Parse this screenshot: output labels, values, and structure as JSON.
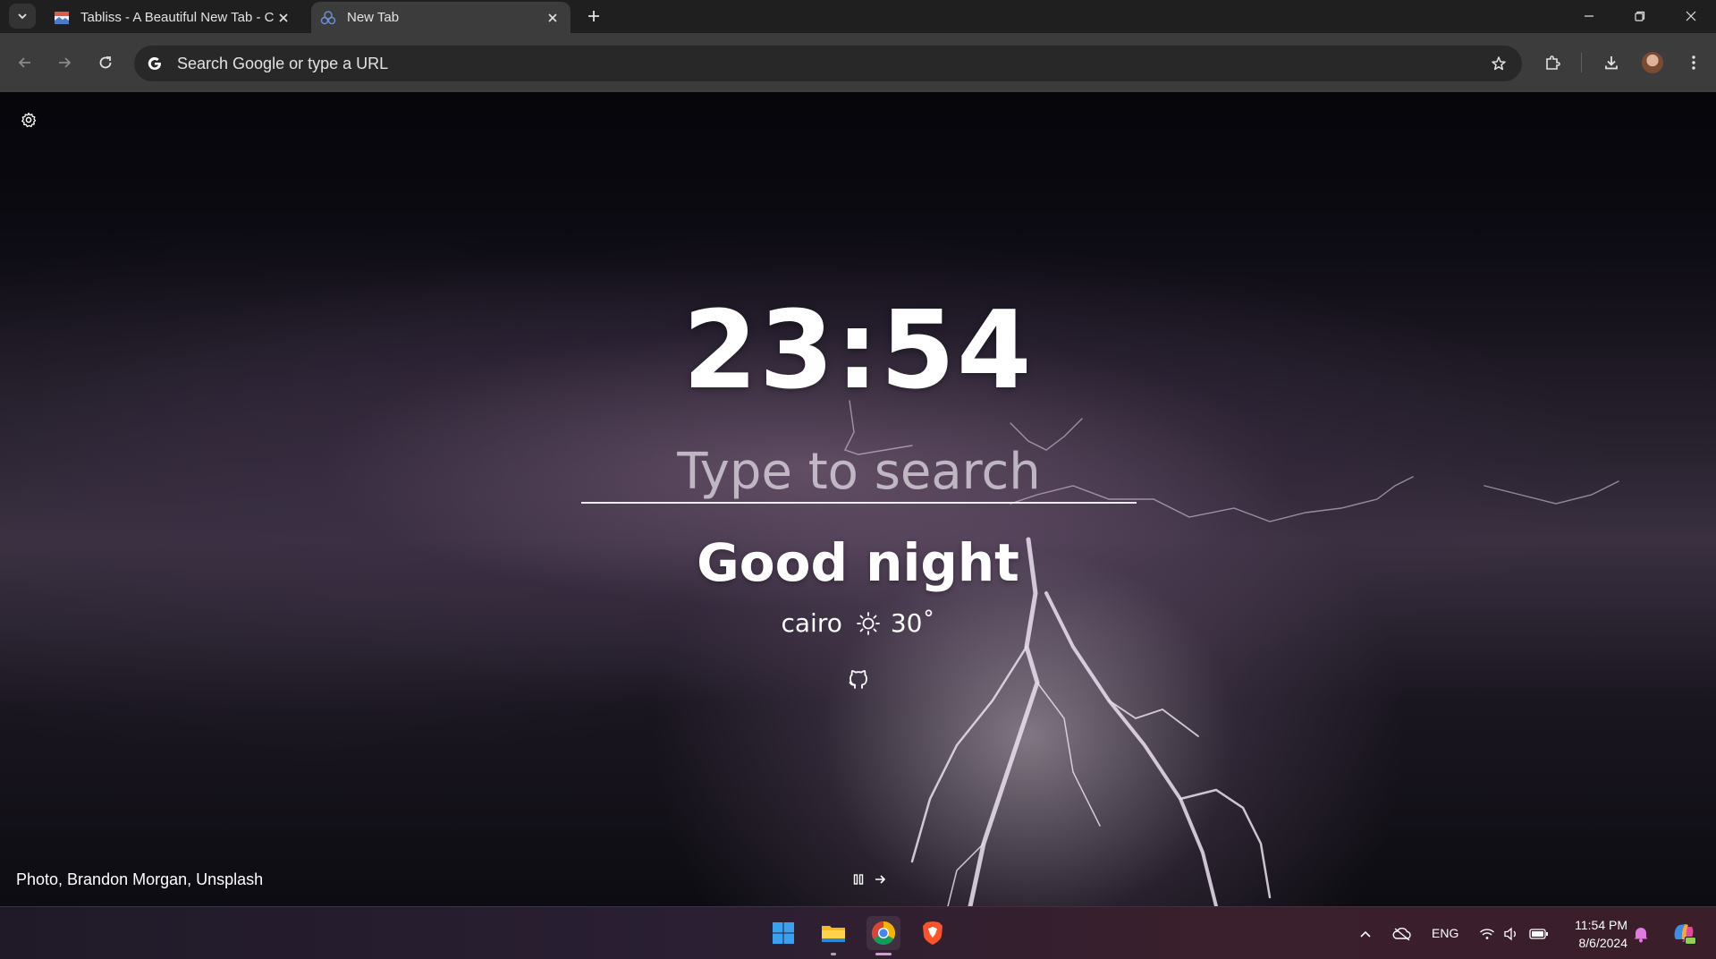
{
  "browser": {
    "tabs": [
      {
        "title": "Tabliss - A Beautiful New Tab - C",
        "active": false
      },
      {
        "title": "New Tab",
        "active": true
      }
    ],
    "omnibox_placeholder": "Search Google or type a URL"
  },
  "newtab": {
    "clock": "23:54",
    "search_placeholder": "Type to search",
    "greeting": "Good night",
    "weather": {
      "city": "cairo",
      "icon": "sun-icon",
      "temperature": "30˚"
    },
    "credit": {
      "prefix": "Photo, ",
      "photographer": "Brandon Morgan",
      "separator": ", ",
      "source": "Unsplash"
    }
  },
  "taskbar": {
    "apps": [
      "start-icon",
      "file-explorer-icon",
      "chrome-icon",
      "brave-icon"
    ],
    "language": "ENG",
    "time": "11:54 PM",
    "date": "8/6/2024"
  },
  "colors": {
    "tabstrip": "#1f1f1f",
    "toolbar": "#3c3c3c",
    "omnibox": "#282828",
    "text": "#ffffff"
  }
}
